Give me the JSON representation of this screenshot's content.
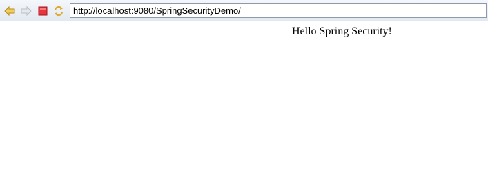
{
  "browser": {
    "address": "http://localhost:9080/SpringSecurityDemo/",
    "icons": {
      "back": "back-arrow-icon",
      "forward": "forward-arrow-icon",
      "stop": "stop-icon",
      "refresh": "refresh-icon"
    },
    "colors": {
      "back_arrow": "#e8b93a",
      "forward_arrow": "#cfd3d8",
      "stop": "#d9262b",
      "refresh": "#e0a92c"
    }
  },
  "page": {
    "message": "Hello Spring Security!"
  }
}
